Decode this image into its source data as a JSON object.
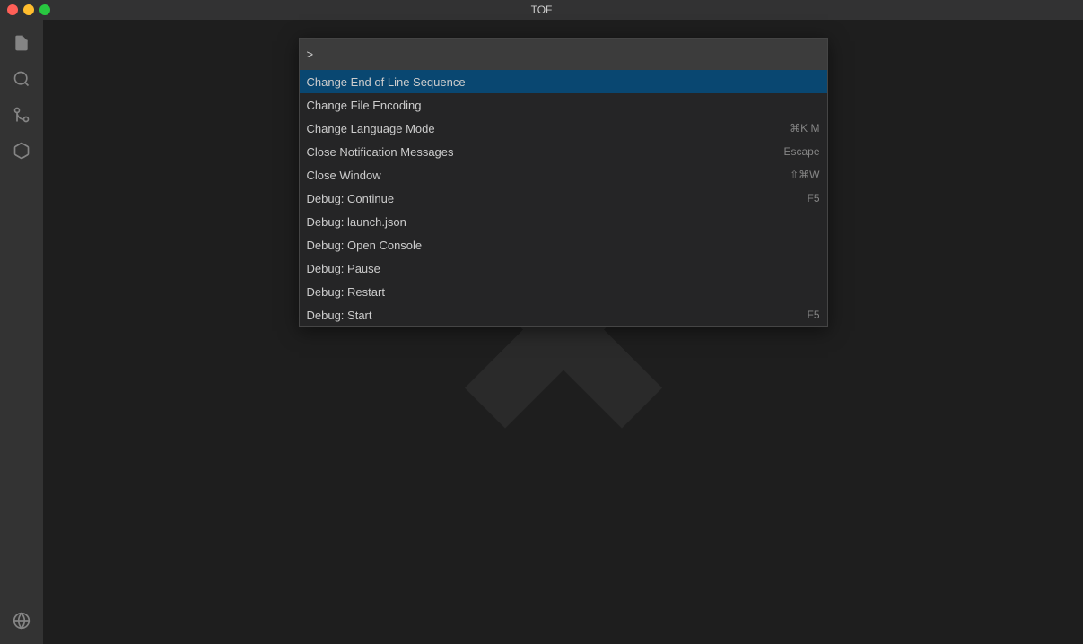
{
  "titleBar": {
    "title": "TOF",
    "buttons": {
      "close": "close",
      "minimize": "minimize",
      "maximize": "maximize"
    }
  },
  "activityBar": {
    "icons": [
      {
        "name": "files-icon",
        "symbol": "⎘"
      },
      {
        "name": "search-icon",
        "symbol": "🔍"
      },
      {
        "name": "source-control-icon",
        "symbol": "⎇"
      },
      {
        "name": "extensions-icon",
        "symbol": "⊞"
      }
    ]
  },
  "commandPalette": {
    "inputPrompt": ">|",
    "inputValue": "",
    "items": [
      {
        "label": "Change End of Line Sequence",
        "shortcut": "",
        "selected": true
      },
      {
        "label": "Change File Encoding",
        "shortcut": ""
      },
      {
        "label": "Change Language Mode",
        "shortcut": "⌘K M"
      },
      {
        "label": "Close Notification Messages",
        "shortcut": "Escape"
      },
      {
        "label": "Close Window",
        "shortcut": "⇧⌘W"
      },
      {
        "label": "Debug: Continue",
        "shortcut": "F5"
      },
      {
        "label": "Debug: launch.json",
        "shortcut": ""
      },
      {
        "label": "Debug: Open Console",
        "shortcut": ""
      },
      {
        "label": "Debug: Pause",
        "shortcut": ""
      },
      {
        "label": "Debug: Restart",
        "shortcut": ""
      },
      {
        "label": "Debug: Start",
        "shortcut": "F5"
      }
    ]
  }
}
